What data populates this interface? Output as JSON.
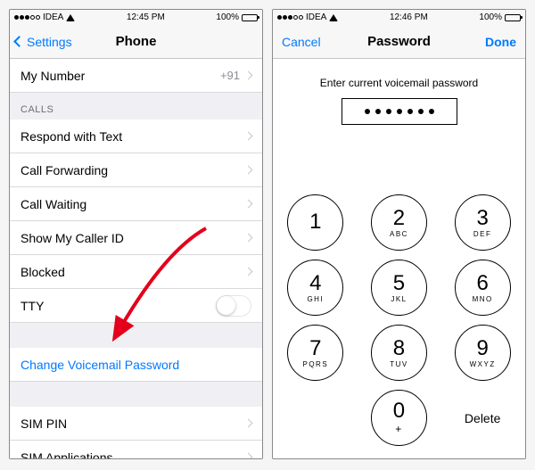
{
  "left": {
    "status": {
      "carrier": "IDEA",
      "time": "12:45 PM",
      "battery": "100%"
    },
    "nav": {
      "back": "Settings",
      "title": "Phone"
    },
    "my_number": {
      "label": "My Number",
      "value": "+91"
    },
    "sections": {
      "calls_header": "CALLS",
      "calls": [
        {
          "label": "Respond with Text"
        },
        {
          "label": "Call Forwarding"
        },
        {
          "label": "Call Waiting"
        },
        {
          "label": "Show My Caller ID"
        },
        {
          "label": "Blocked"
        }
      ],
      "tty_label": "TTY",
      "tty_on": false,
      "change_vm": "Change Voicemail Password",
      "sim": [
        {
          "label": "SIM PIN"
        },
        {
          "label": "SIM Applications"
        }
      ]
    }
  },
  "right": {
    "status": {
      "carrier": "IDEA",
      "time": "12:46 PM",
      "battery": "100%"
    },
    "nav": {
      "cancel": "Cancel",
      "title": "Password",
      "done": "Done"
    },
    "prompt": "Enter current voicemail password",
    "dots_entered": 7,
    "keypad": [
      {
        "num": "1",
        "let": ""
      },
      {
        "num": "2",
        "let": "ABC"
      },
      {
        "num": "3",
        "let": "DEF"
      },
      {
        "num": "4",
        "let": "GHI"
      },
      {
        "num": "5",
        "let": "JKL"
      },
      {
        "num": "6",
        "let": "MNO"
      },
      {
        "num": "7",
        "let": "PQRS"
      },
      {
        "num": "8",
        "let": "TUV"
      },
      {
        "num": "9",
        "let": "WXYZ"
      }
    ],
    "zero": {
      "num": "0",
      "let": "+"
    },
    "delete": "Delete"
  }
}
